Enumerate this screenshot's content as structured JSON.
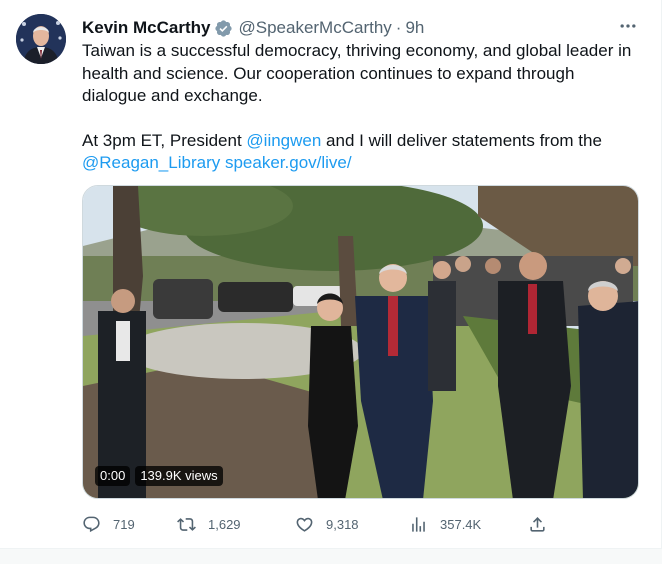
{
  "author": {
    "name": "Kevin McCarthy",
    "handle": "@SpeakerMcCarthy",
    "separator": "·",
    "time": "9h",
    "verified": true
  },
  "tweet": {
    "paragraph1": "Taiwan is a successful democracy, thriving economy, and global leader in health and science. Our cooperation continues to expand through dialogue and exchange.",
    "paragraph2_part1": "At 3pm ET, President ",
    "mention1": "@iingwen",
    "paragraph2_part2": " and I will deliver statements from the ",
    "mention2": "@Reagan_Library",
    "space": " ",
    "url": "speaker.gov/live/"
  },
  "media": {
    "timestamp": "0:00",
    "views": "139.9K views"
  },
  "actions": {
    "replies": "719",
    "retweets": "1,629",
    "likes": "9,318",
    "views": "357.4K"
  },
  "icons": {
    "verified": "verified-badge-icon",
    "more": "more-horizontal-icon",
    "reply": "reply-icon",
    "retweet": "retweet-icon",
    "like": "heart-icon",
    "views": "analytics-icon",
    "share": "share-icon"
  },
  "colors": {
    "link": "#1d9bf0",
    "secondary_text": "#536471",
    "primary_text": "#0f1419"
  }
}
